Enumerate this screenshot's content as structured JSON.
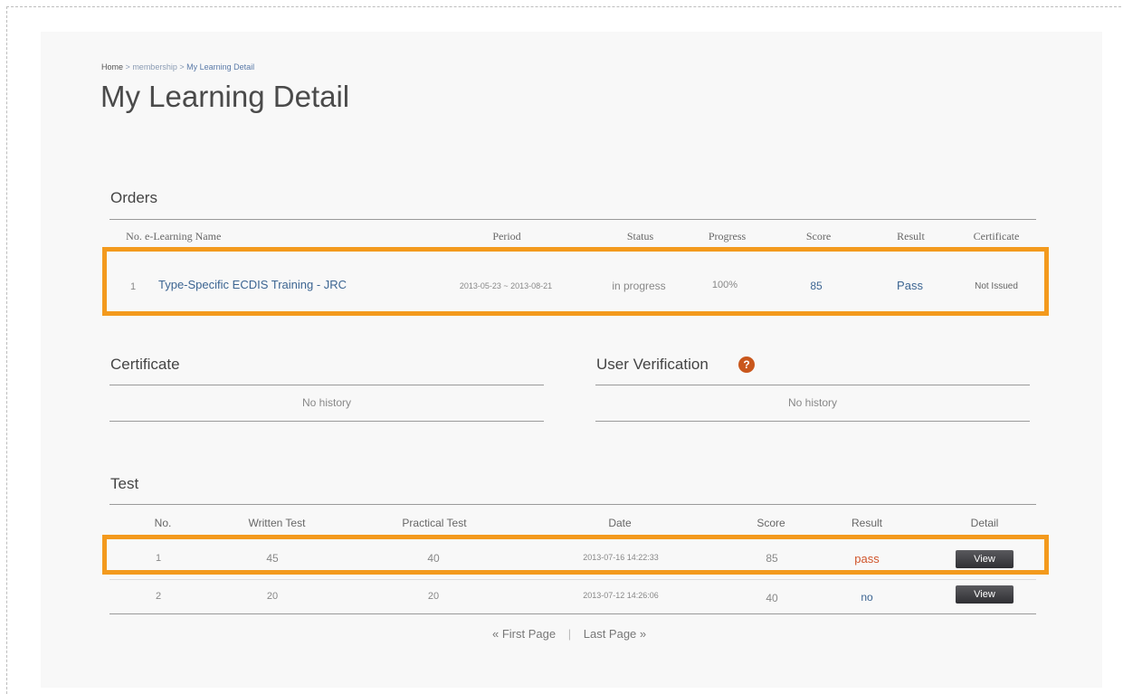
{
  "breadcrumb": {
    "home": "Home",
    "sep1": ">",
    "section": "membership",
    "sep2": ">",
    "current": "My Learning Detail"
  },
  "page_title": "My Learning Detail",
  "orders": {
    "title": "Orders",
    "headers": [
      "No.",
      "e-Learning Name",
      "Period",
      "Status",
      "Progress",
      "Score",
      "Result",
      "Certificate"
    ],
    "rows": [
      {
        "no": "1",
        "name": "Type-Specific ECDIS Training - JRC",
        "period": "2013-05-23 ~ 2013-08-21",
        "status": "in progress",
        "progress": "100%",
        "score": "85",
        "result": "Pass",
        "certificate": "Not Issued"
      }
    ]
  },
  "certificate": {
    "title": "Certificate",
    "empty": "No history"
  },
  "user_verification": {
    "title": "User Verification",
    "help_icon": "?",
    "empty": "No history"
  },
  "test": {
    "title": "Test",
    "headers": [
      "No.",
      "Written Test",
      "Practical Test",
      "Date",
      "Score",
      "Result",
      "Detail"
    ],
    "rows": [
      {
        "no": "1",
        "written": "45",
        "practical": "40",
        "date": "2013-07-16 14:22:33",
        "score": "85",
        "result": "pass",
        "detail": "View"
      },
      {
        "no": "2",
        "written": "20",
        "practical": "20",
        "date": "2013-07-12 14:26:06",
        "score": "40",
        "result": "no",
        "detail": "View"
      }
    ]
  },
  "pager": {
    "first": "« First Page",
    "sep": "|",
    "last": "Last Page »"
  },
  "colors": {
    "highlight": "#f39a1d",
    "link": "#3c6592",
    "pass_red": "#d0542a"
  }
}
